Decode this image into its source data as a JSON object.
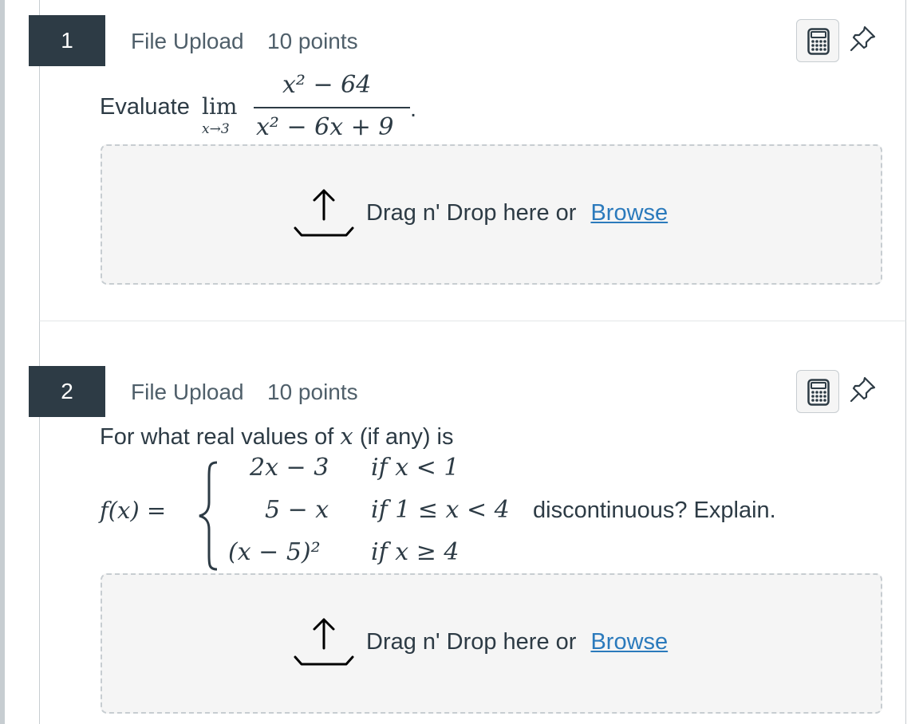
{
  "questions": [
    {
      "number": "1",
      "type": "File Upload",
      "points": "10 points",
      "prompt_prefix": "Evaluate",
      "limit_word": "lim",
      "limit_sub": "x→3",
      "numerator": "x² − 64",
      "denominator": "x² − 6x + 9",
      "period": ".",
      "dropzone_text": "Drag n' Drop here or",
      "browse_label": "Browse"
    },
    {
      "number": "2",
      "type": "File Upload",
      "points": "10 points",
      "prompt_line1_pre": "For what real values of",
      "prompt_var": "x",
      "prompt_line1_post": "(if any) is",
      "func_lhs": "f(x) =",
      "cases": [
        {
          "expr": "2x − 3",
          "cond": "if x < 1"
        },
        {
          "expr": "5 − x",
          "cond": "if 1 ≤ x < 4"
        },
        {
          "expr": "(x − 5)²",
          "cond": "if x ≥ 4"
        }
      ],
      "suffix": "discontinuous? Explain.",
      "dropzone_text": "Drag n' Drop here or",
      "browse_label": "Browse"
    }
  ],
  "icons": {
    "calculator": "calculator-icon",
    "pin": "pin-icon",
    "upload": "upload-icon"
  },
  "colors": {
    "number_bg": "#2d3b45",
    "link": "#2b7abc",
    "dropzone_bg": "#f5f5f5",
    "border": "#c7cdd1"
  }
}
